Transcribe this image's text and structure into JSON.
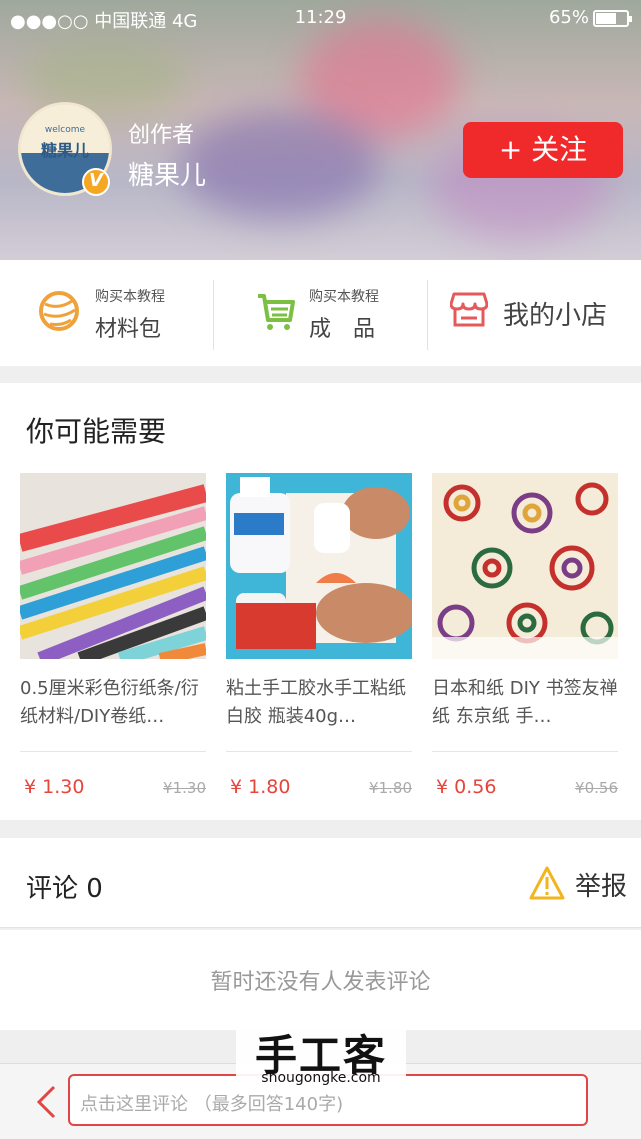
{
  "status_bar": {
    "carrier": "●●●○○ 中国联通  4G",
    "time": "11:29",
    "battery": "65%",
    "battery_level": 0.65
  },
  "header": {
    "avatar_welcome": "welcome",
    "avatar_name": "糖果儿",
    "verified_badge": "V",
    "role": "创作者",
    "username": "糖果儿",
    "follow_label": "+ 关注"
  },
  "shortcuts": [
    {
      "sub": "购买本教程",
      "label": "材料包",
      "icon": "yarn-ball-icon",
      "color": "#f0a23a"
    },
    {
      "sub": "购买本教程",
      "label": "成　品",
      "icon": "cart-icon",
      "color": "#7bc043"
    },
    {
      "sub": "",
      "label": "我的小店",
      "icon": "shop-icon",
      "color": "#e45a5a"
    }
  ],
  "recommend": {
    "title": "你可能需要",
    "products": [
      {
        "title": "0.5厘米彩色衍纸条/衍纸材料/DIY卷纸…",
        "price": "¥ 1.30",
        "original_price": "¥1.30"
      },
      {
        "title": "粘土手工胶水手工粘纸白胶 瓶装40g…",
        "price": "¥ 1.80",
        "original_price": "¥1.80"
      },
      {
        "title": "日本和纸 DIY 书签友禅纸 东京纸 手…",
        "price": "¥ 0.56",
        "original_price": "¥0.56"
      }
    ]
  },
  "comments": {
    "title": "评论 0",
    "report_label": "举报",
    "empty_text": "暂时还没有人发表评论"
  },
  "bottom_bar": {
    "placeholder": "点击这里评论 （最多回答140字)"
  },
  "watermark": {
    "name": "手工客",
    "url": "shougongke.com"
  },
  "colors": {
    "accent": "#f02a2a",
    "price": "#e6453c"
  }
}
